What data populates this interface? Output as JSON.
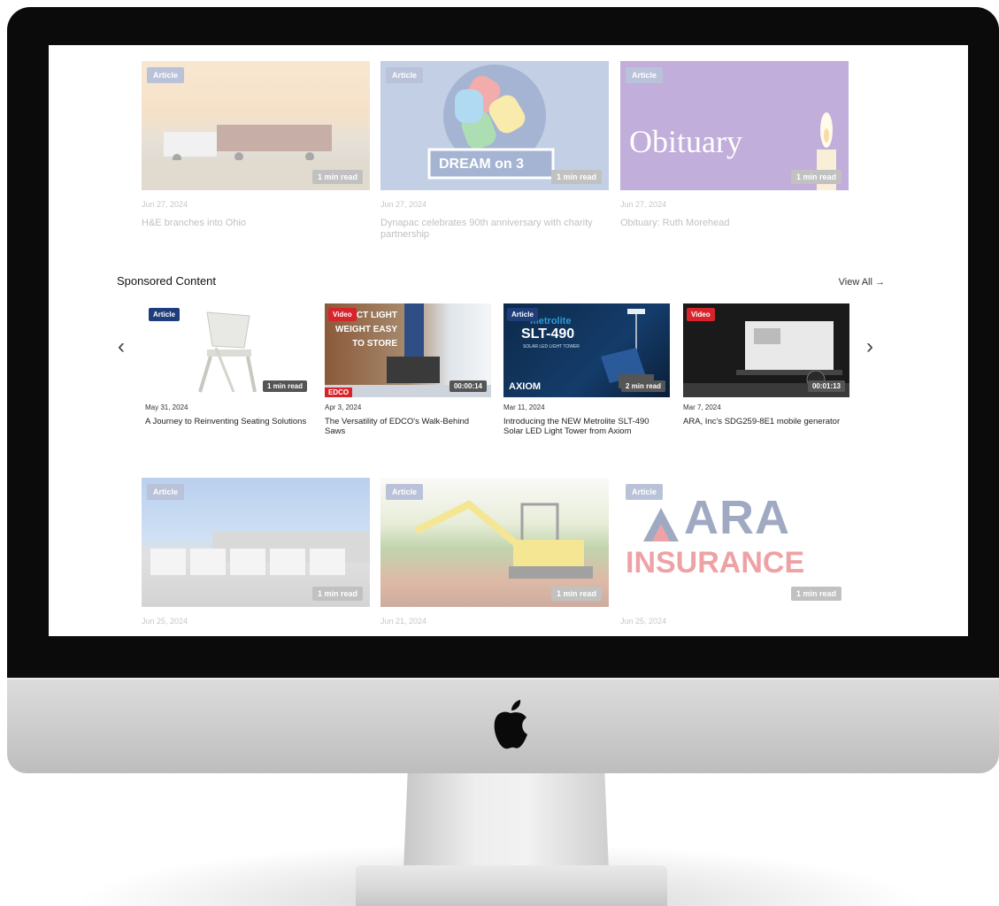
{
  "top_row": [
    {
      "badge": "Article",
      "read_time": "1 min read",
      "date": "Jun 27, 2024",
      "title": "H&E branches into Ohio"
    },
    {
      "badge": "Article",
      "read_time": "1 min read",
      "date": "Jun 27, 2024",
      "title": "Dynapac celebrates 90th anniversary with charity partnership",
      "logo_text": "DREAM on 3"
    },
    {
      "badge": "Article",
      "read_time": "1 min read",
      "date": "Jun 27, 2024",
      "title": "Obituary: Ruth Morehead",
      "image_text": "Obituary"
    }
  ],
  "sponsored": {
    "heading": "Sponsored Content",
    "view_all": "View All →",
    "prev_arrow": "‹",
    "next_arrow": "›",
    "items": [
      {
        "badge": "Article",
        "read_time": "1 min read",
        "date": "May 31, 2024",
        "title": "A Journey to Reinventing Seating Solutions"
      },
      {
        "badge": "Video",
        "read_time": "00:00:14",
        "date": "Apr 3, 2024",
        "title": "The Versatility of EDCO's Walk-Behind Saws",
        "image_text": "PACT LIGHT WEIGHT EASY TO STORE",
        "brand": "EDCO"
      },
      {
        "badge": "Article",
        "read_time": "2 min read",
        "date": "Mar 11, 2024",
        "title": "Introducing the NEW Metrolite SLT-490 Solar LED Light Tower from Axiom",
        "image_text_brand": "metrolite",
        "image_text_model": "SLT-490",
        "image_text_sub": "SOLAR LED LIGHT TOWER",
        "logo": "AXIOM"
      },
      {
        "badge": "Video",
        "read_time": "00:01:13",
        "date": "Mar 7, 2024",
        "title": "ARA, Inc's SDG259-8E1 mobile generator"
      }
    ]
  },
  "bottom_row": [
    {
      "badge": "Article",
      "read_time": "1 min read",
      "date": "Jun 25, 2024"
    },
    {
      "badge": "Article",
      "read_time": "1 min read",
      "date": "Jun 21, 2024"
    },
    {
      "badge": "Article",
      "read_time": "1 min read",
      "date": "Jun 25, 2024",
      "logo_line1": "ARA",
      "logo_line2": "INSURANCE"
    }
  ]
}
